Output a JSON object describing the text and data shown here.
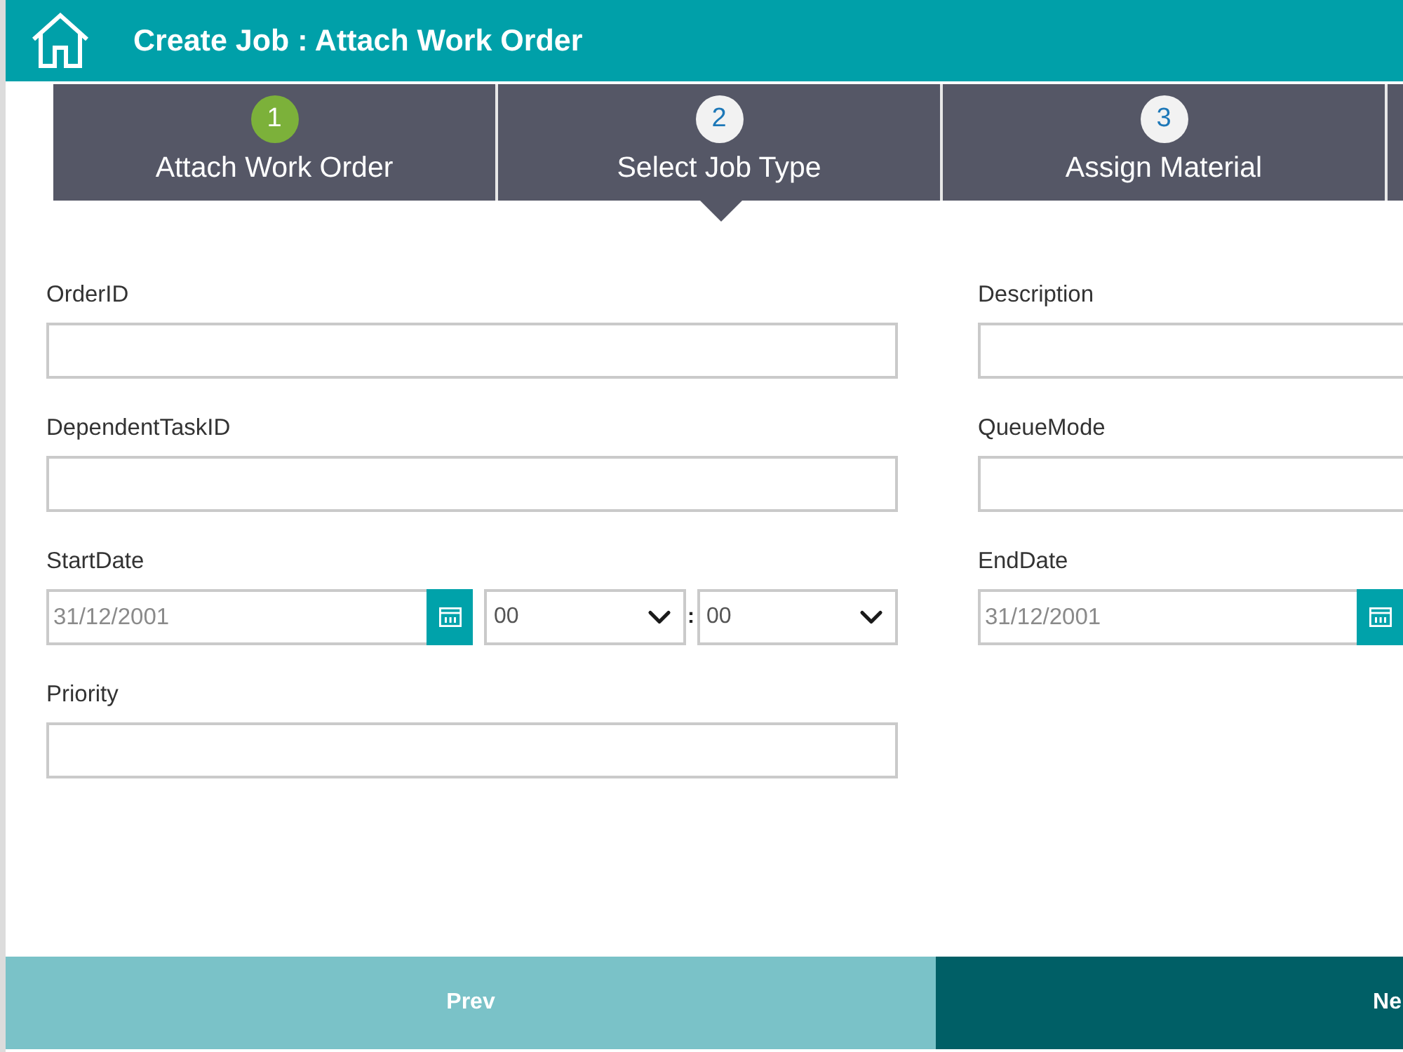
{
  "header": {
    "title": "Create Job : Attach Work Order"
  },
  "steps": [
    {
      "number": "1",
      "label": "Attach Work Order",
      "completed": true,
      "selected": false
    },
    {
      "number": "2",
      "label": "Select Job Type",
      "completed": false,
      "selected": true
    },
    {
      "number": "3",
      "label": "Assign Material",
      "completed": false,
      "selected": false
    }
  ],
  "form": {
    "left": [
      {
        "kind": "text",
        "label": "OrderID"
      },
      {
        "kind": "text",
        "label": "DependentTaskID"
      },
      {
        "kind": "datetime",
        "label": "StartDate",
        "placeholder": "31/12/2001",
        "hour": "00",
        "separator": ":",
        "minute": "00"
      },
      {
        "kind": "text",
        "label": "Priority"
      }
    ],
    "right": [
      {
        "kind": "text",
        "label": "Description"
      },
      {
        "kind": "text",
        "label": "QueueMode"
      },
      {
        "kind": "date",
        "label": "EndDate",
        "placeholder": "31/12/2001"
      }
    ]
  },
  "buttons": {
    "prev": "Prev",
    "next": "Ne"
  }
}
